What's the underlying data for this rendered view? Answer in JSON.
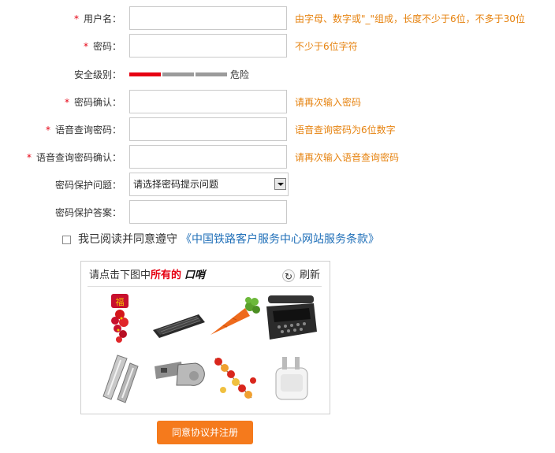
{
  "form": {
    "fields": [
      {
        "key": "username",
        "label": "用户名：",
        "required": true,
        "hint": "由字母、数字或\"_\"组成，长度不少于6位，不多于30位",
        "value": ""
      },
      {
        "key": "password",
        "label": "密码：",
        "required": true,
        "hint": "不少于6位字符",
        "value": ""
      },
      {
        "key": "confirm_password",
        "label": "密码确认：",
        "required": true,
        "hint": "请再次输入密码",
        "value": ""
      },
      {
        "key": "voice_password",
        "label": "语音查询密码：",
        "required": true,
        "hint": "语音查询密码为6位数字",
        "value": ""
      },
      {
        "key": "voice_password_confirm",
        "label": "语音查询密码确认：",
        "required": true,
        "hint": "请再次输入语音查询密码",
        "value": ""
      }
    ],
    "required_mark": "*",
    "security": {
      "label": "安全级别：",
      "level_text": "危险",
      "level": 0.33,
      "colors": {
        "active": "#e60012",
        "inactive": "#9b9b9b"
      }
    },
    "question": {
      "label": "密码保护问题：",
      "selected": "请选择密码提示问题"
    },
    "answer": {
      "label": "密码保护答案：",
      "value": ""
    },
    "agree": {
      "text": "我已阅读并同意遵守",
      "link": "《中国铁路客户服务中心网站服务条款》",
      "checked": false
    }
  },
  "captcha": {
    "instruction_prefix": "请点击下图中",
    "instruction_highlight": "所有的",
    "target_word": "口哨",
    "refresh_label": "刷新",
    "images": [
      "fu-fortune-charm-icon",
      "computer-keyboard-icon",
      "carrot-icon",
      "typewriter-icon",
      "metal-whistle-icon",
      "silver-whistle-icon",
      "firecracker-string-icon",
      "power-plug-adapter-icon"
    ]
  },
  "submit": {
    "label": "同意协议并注册"
  },
  "colors": {
    "hint": "#e6820e",
    "required": "#e60012",
    "link": "#1f6fb8",
    "button": "#f57a1c"
  }
}
